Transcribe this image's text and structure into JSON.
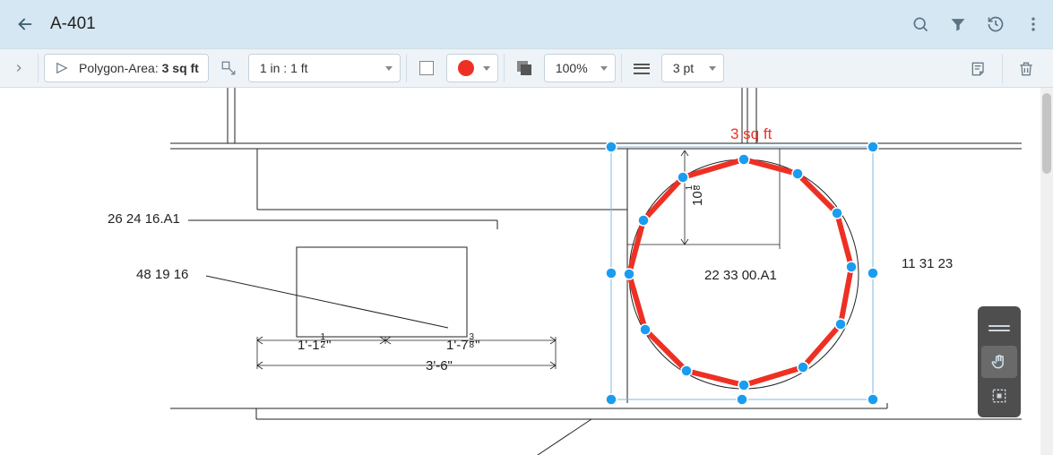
{
  "header": {
    "title": "A-401"
  },
  "toolbar": {
    "polygon_prefix": "Polygon-Area: ",
    "polygon_value": "3 sq ft",
    "scale": "1 in : 1 ft",
    "opacity": "100%",
    "stroke": "3 pt"
  },
  "colors": {
    "selection": "#1a73e8",
    "handle_fill": "#1a9df0",
    "polygon_stroke": "#ee3024"
  },
  "drawing": {
    "labels": {
      "left_callout_1": "26 24 16.A1",
      "left_callout_2": "48 19 16",
      "dim_small_left": "1'-1",
      "dim_small_left_frac_top": "1",
      "dim_small_left_frac_bot": "2",
      "dim_small_left_suffix": "\"",
      "dim_small_right": "1'-7",
      "dim_small_right_frac_top": "3",
      "dim_small_right_frac_bot": "8",
      "dim_small_right_suffix": "\"",
      "dim_large": "3'-6\"",
      "circle_label": "22 33 00.A1",
      "vdim": "10",
      "vdim_frac_top": "1",
      "vdim_frac_bot": "8",
      "right_label": "11 31 23",
      "area_label": "3 sq ft"
    }
  }
}
